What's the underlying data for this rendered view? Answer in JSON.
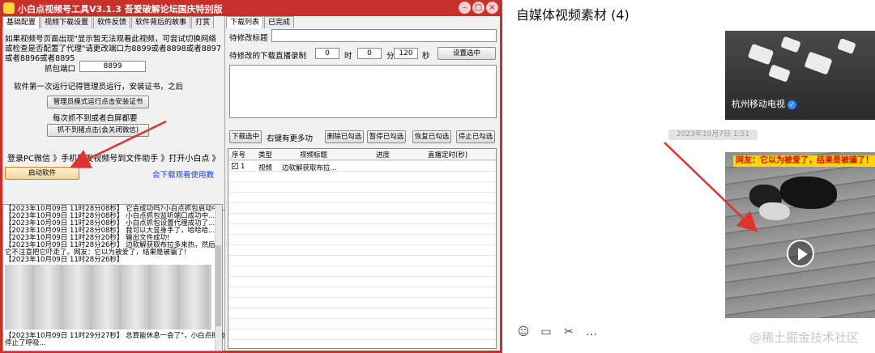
{
  "app": {
    "title": "小白点视频号工具V3.1.3 吾爱破解论坛国庆特别版",
    "tabs": [
      "基础配置",
      "视频下载设置",
      "软件反馈",
      "软件背后的故事",
      "打赏"
    ],
    "intro_text": "如果视频号页面出现\"显示暂无法观看此视频，可尝试切换网络或检查是否配置了代理\"请更改端口为8899或者8898或者8897或者8896或者8895",
    "port_label": "抓包端口",
    "port_value": "8899",
    "cert_note": "软件第一次运行记得管理员运行，安装证书，之后",
    "admin_btn": "管理员模式运行点击安装证书",
    "retry_note": "每次抓不到或者白屏都要",
    "cant_grab_btn": "抓不到猪点击(会关闭微信)",
    "steps_text": "登录PC微信 》手机转发视频号到文件助手 》打开小白点 》",
    "start_btn": "启动软件",
    "help_link": "会下载观看使用教",
    "log_lines": [
      "【2023年10月09日 11时28分08秒】 它会成功吗?小白点抓包启动中...",
      "【2023年10月09日 11时28分08秒】 小白点抓包监听端口成功中...",
      "【2023年10月09日 11时28分08秒】 小白点抓包设置代理成功了...",
      "【2023年10月09日 11时28分08秒】 我可以大显身手了，哈哈哈...",
      "【2023年10月09日 11时28分20秒】 输出文件成功!",
      "【2023年10月09日 11时28分26秒】 边软解获取布拉多来热，然后载",
      "它不注意把它吓走了。网友：它以为被爱了，结果是被骗了!",
      "【2023年10月09日 11时28分26秒】"
    ],
    "log_bottom_lines": [
      "【2023年10月09日 11时29分27秒】 总算能休息一会了\"，小白点抓包",
      "停止了呼吸..."
    ],
    "right_tabs": [
      "下载列表",
      "已完成"
    ],
    "title_field_label": "待修改标题",
    "time_label": "待修改的下载直播录制",
    "hours_value": "0",
    "hours_unit": "时",
    "minutes_value": "0",
    "minutes_unit": "分",
    "seconds_value": "120",
    "seconds_unit": "秒",
    "set_selected_btn": "设置选中",
    "download_selected_btn": "下载选中",
    "right_click_note": "右键有更多功",
    "delete_checked_btn": "删除已勾选",
    "pause_checked_btn": "暂停已勾选",
    "resume_checked_btn": "恢复已勾选",
    "stop_checked_btn": "停止已勾选",
    "grid_headers": [
      "序号",
      "类型",
      "视频标题",
      "进度",
      "直播定时(秒)"
    ],
    "grid_row": {
      "index": "1",
      "type": "视频",
      "title": "边软解获取布拉...",
      "checked": true
    }
  },
  "chat": {
    "title": "自媒体视频素材 (4)",
    "top_video_channel": "杭州移动电视",
    "timestamp": "2023年10月7日 1:51",
    "video_caption": "网友：它以为被爱了，结果是被骗了！",
    "toolbar_icons": [
      "emoji-icon",
      "folder-icon",
      "scissors-icon",
      "chat-bubble-icon"
    ],
    "watermark": "@稀土掘金技术社区"
  },
  "colors": {
    "window_frame": "#c8302c",
    "arrow": "#e0322f",
    "caption_bg": "#ffd600",
    "caption_text": "#d01010",
    "link": "#1a3ee6"
  }
}
